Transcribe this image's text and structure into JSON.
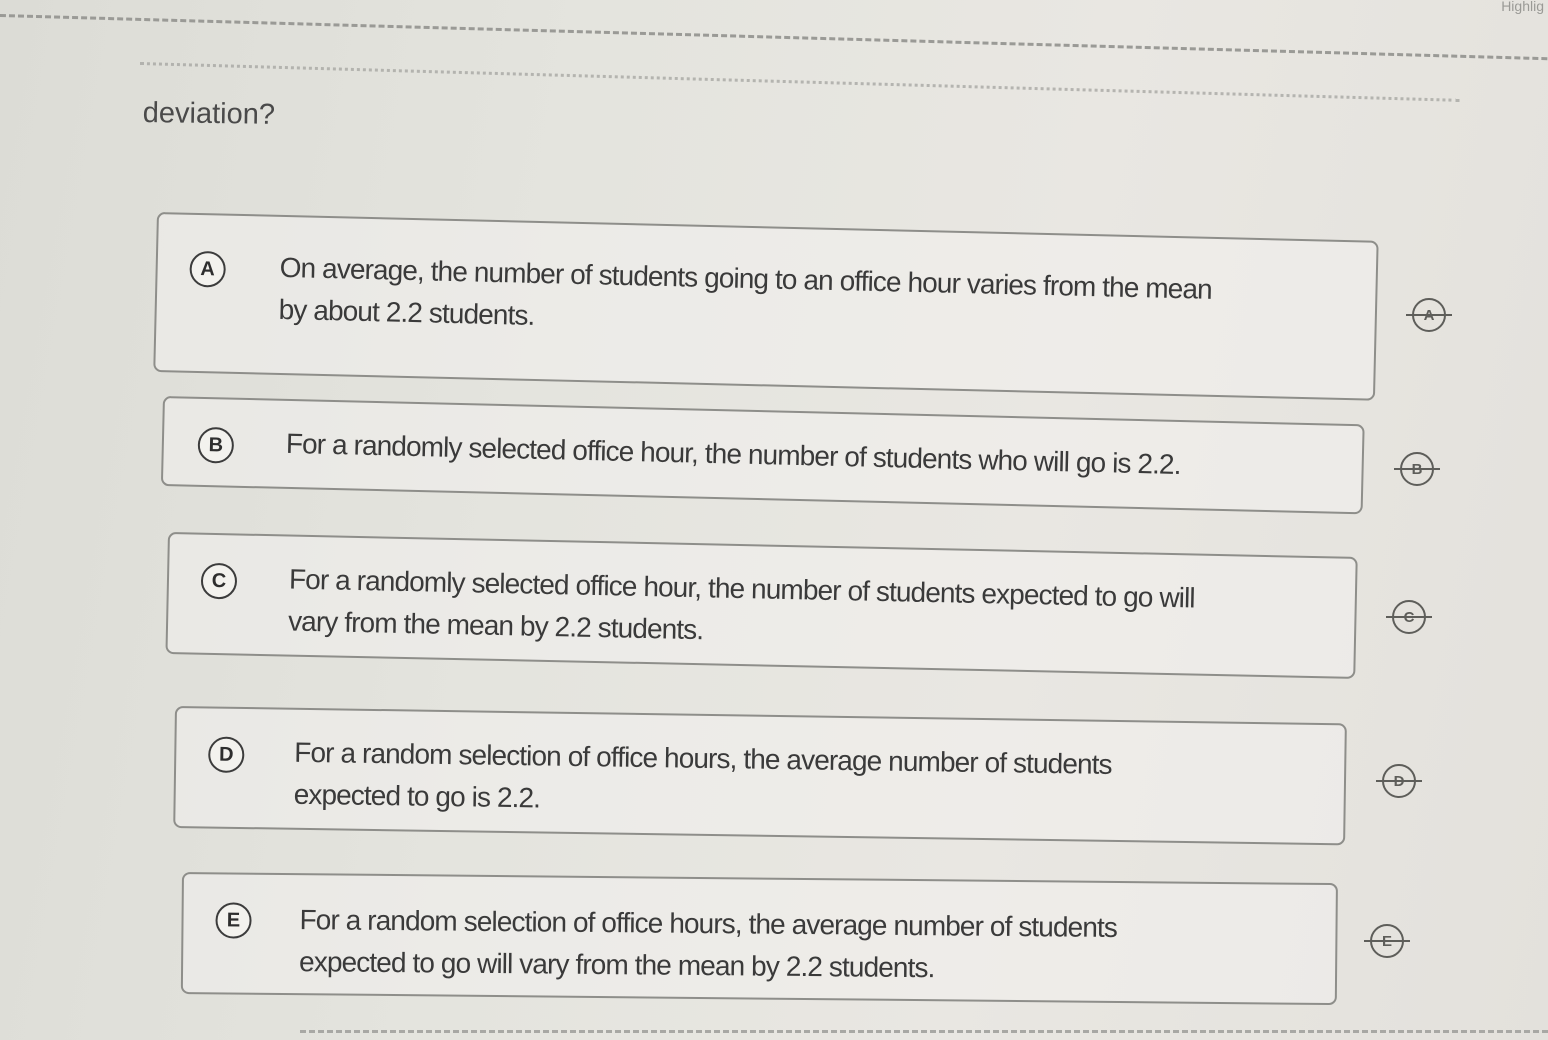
{
  "question": {
    "text": "deviation?"
  },
  "corner_label": "Highlig",
  "choices": [
    {
      "letter": "A",
      "line1": "On average, the number of students going to an office hour varies from the mean",
      "line2": "by about 2.2 students."
    },
    {
      "letter": "B",
      "line1": "For a randomly selected office hour, the number of students who will go is 2.2.",
      "line2": ""
    },
    {
      "letter": "C",
      "line1": "For a randomly selected office hour, the number of students expected to go will",
      "line2": "vary from the mean by 2.2 students."
    },
    {
      "letter": "D",
      "line1": "For a random selection of office hours, the average number of students",
      "line2": "expected to go is 2.2."
    },
    {
      "letter": "E",
      "line1": "For a random selection of office hours, the average number of students",
      "line2": "expected to go will vary from the mean by 2.2 students."
    }
  ]
}
